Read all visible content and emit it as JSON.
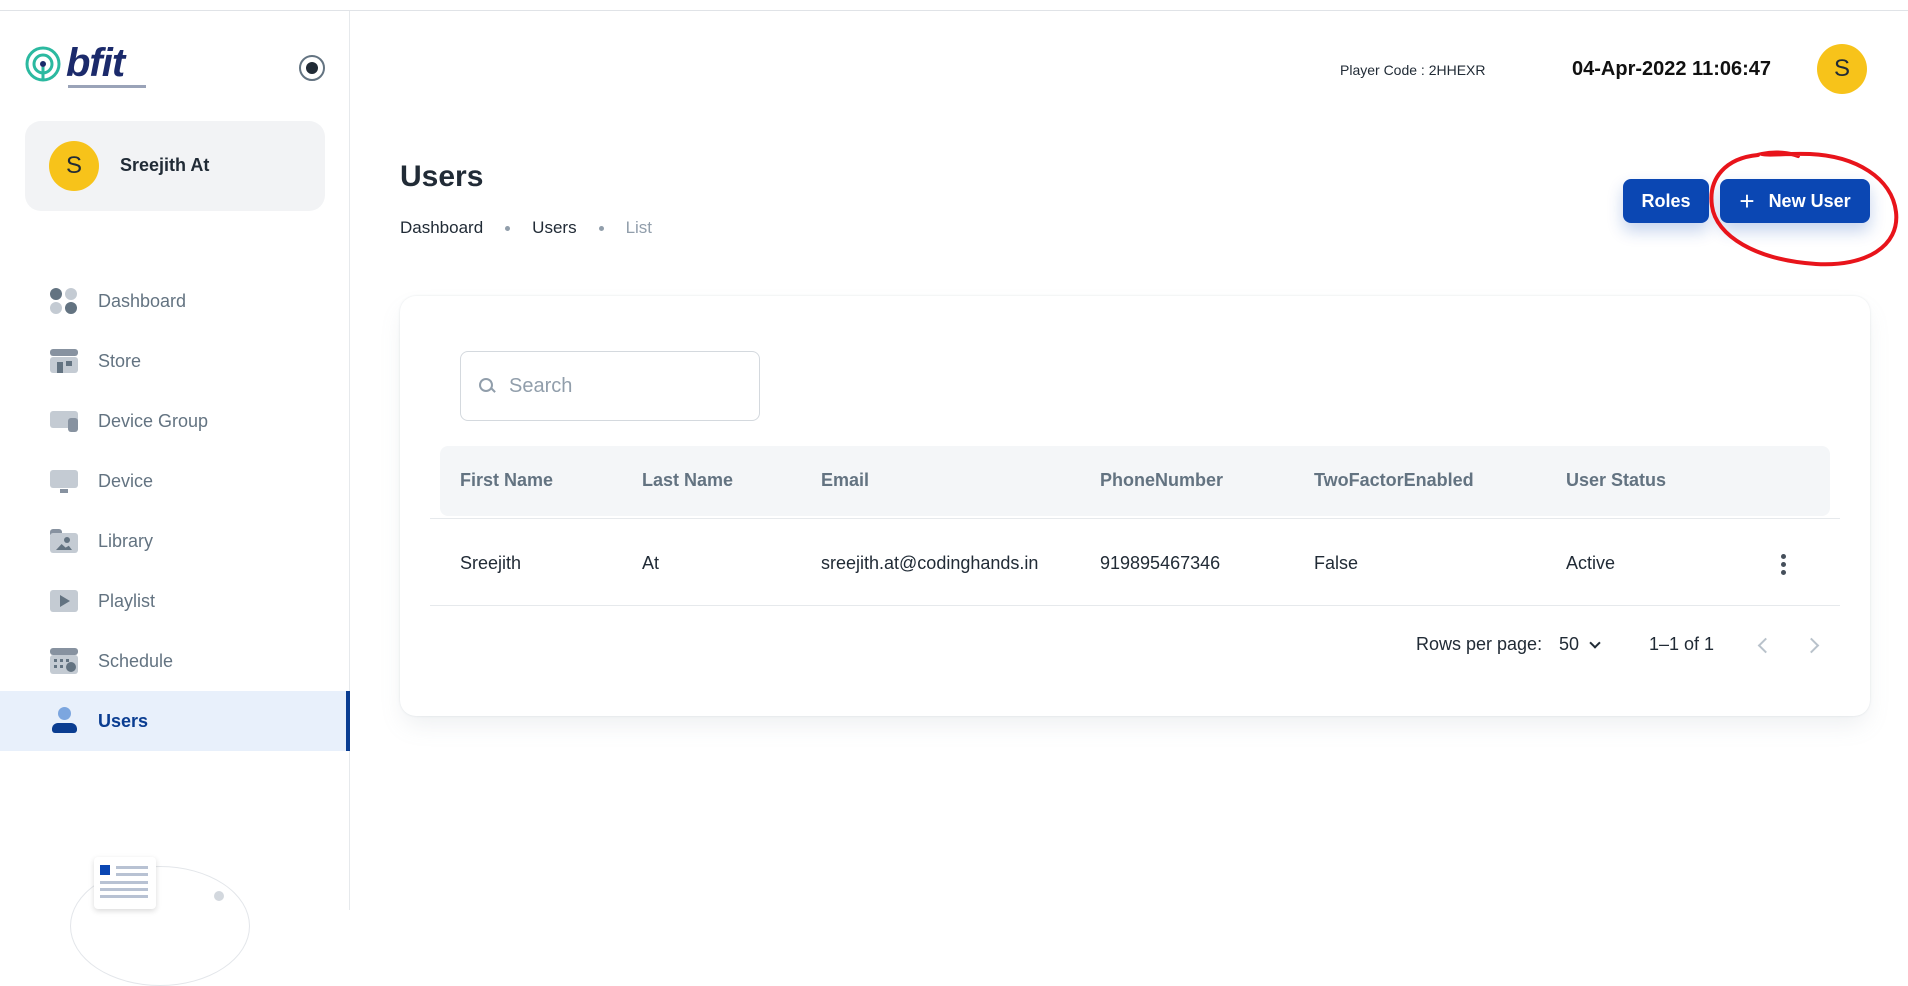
{
  "header": {
    "player_code": "Player Code : 2HHEXR",
    "datetime": "04-Apr-2022 11:06:47",
    "avatar_initial": "S"
  },
  "brand": {
    "logo_text": "bfit"
  },
  "account": {
    "initial": "S",
    "name": "Sreejith At"
  },
  "sidebar": {
    "items": [
      {
        "label": "Dashboard",
        "icon": "dashboard-icon"
      },
      {
        "label": "Store",
        "icon": "store-icon"
      },
      {
        "label": "Device Group",
        "icon": "device-group-icon"
      },
      {
        "label": "Device",
        "icon": "device-icon"
      },
      {
        "label": "Library",
        "icon": "library-icon"
      },
      {
        "label": "Playlist",
        "icon": "playlist-icon"
      },
      {
        "label": "Schedule",
        "icon": "schedule-icon"
      },
      {
        "label": "Users",
        "icon": "user-icon",
        "active": true
      }
    ]
  },
  "page": {
    "title": "Users",
    "breadcrumb": [
      "Dashboard",
      "Users",
      "List"
    ],
    "roles_label": "Roles",
    "new_user_label": "New User"
  },
  "search": {
    "placeholder": "Search",
    "value": ""
  },
  "table": {
    "columns": [
      "First Name",
      "Last Name",
      "Email",
      "PhoneNumber",
      "TwoFactorEnabled",
      "User Status"
    ],
    "rows": [
      [
        "Sreejith",
        "At",
        "sreejith.at@codinghands.in",
        "919895467346",
        "False",
        "Active"
      ]
    ]
  },
  "pagination": {
    "rows_per_page_label": "Rows per page:",
    "rows_per_page": "50",
    "range": "1–1 of 1"
  },
  "colors": {
    "primary": "#0b47b3",
    "avatar": "#f7c31a",
    "annotation": "#e8141b",
    "active_nav": "#0a3d91"
  }
}
